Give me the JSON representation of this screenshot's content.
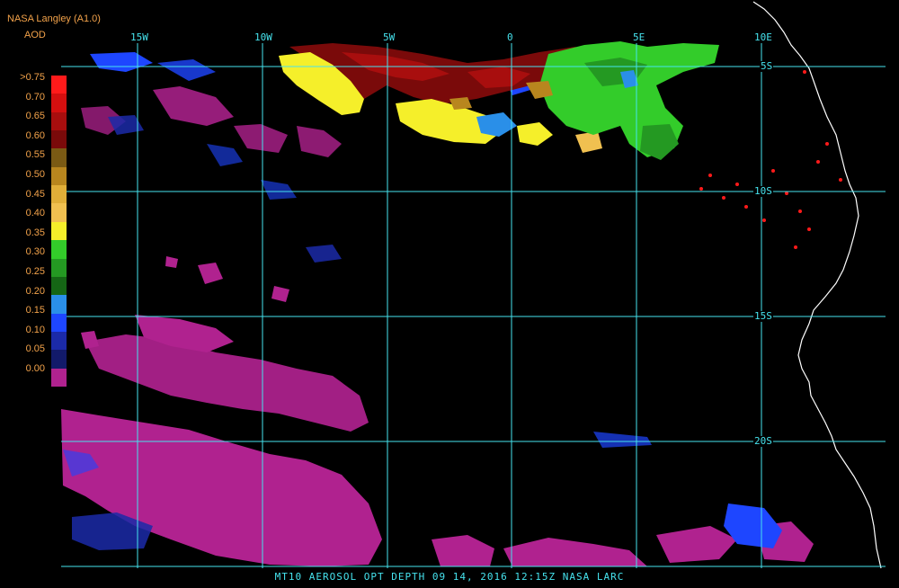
{
  "header": {
    "source": "NASA Langley (A1.0)",
    "product": "AOD"
  },
  "legend": {
    "labels": [
      ">0.75",
      "0.70",
      "0.65",
      "0.60",
      "0.55",
      "0.50",
      "0.45",
      "0.40",
      "0.35",
      "0.30",
      "0.25",
      "0.20",
      "0.15",
      "0.10",
      "0.05",
      "0.00"
    ],
    "colors": [
      "#ff1a1a",
      "#d40f0f",
      "#a80e0e",
      "#7a0a0a",
      "#7a5a14",
      "#b8861e",
      "#e0ae38",
      "#f0c050",
      "#f5ef2a",
      "#33cc2a",
      "#249922",
      "#156615",
      "#2a8fe8",
      "#1e46ff",
      "#1b2aa8",
      "#121a6a",
      "#b0228f"
    ]
  },
  "axes": {
    "longitude": [
      "15W",
      "10W",
      "5W",
      "0",
      "5E",
      "10E"
    ],
    "latitude": [
      "5S",
      "10S",
      "15S",
      "20S"
    ]
  },
  "footer": {
    "caption": "MT10  AEROSOL OPT DEPTH   09 14, 2016 12:15Z   NASA LARC"
  }
}
